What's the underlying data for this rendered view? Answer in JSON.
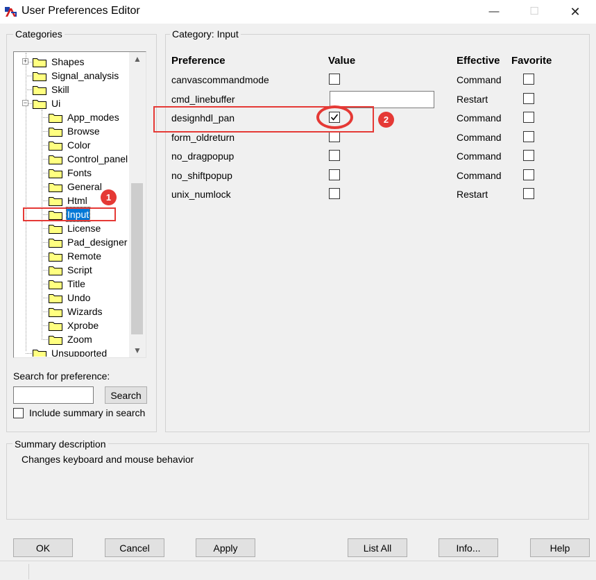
{
  "window": {
    "title": "User Preferences Editor",
    "minimize_glyph": "—",
    "maximize_glyph": "☐",
    "close_glyph": "✕"
  },
  "categories": {
    "title": "Categories",
    "tree": [
      {
        "label": "Shapes",
        "depth": 1,
        "expander": "+"
      },
      {
        "label": "Signal_analysis",
        "depth": 1
      },
      {
        "label": "Skill",
        "depth": 1
      },
      {
        "label": "Ui",
        "depth": 1,
        "expander": "−"
      },
      {
        "label": "App_modes",
        "depth": 2
      },
      {
        "label": "Browse",
        "depth": 2
      },
      {
        "label": "Color",
        "depth": 2
      },
      {
        "label": "Control_panel",
        "depth": 2
      },
      {
        "label": "Fonts",
        "depth": 2
      },
      {
        "label": "General",
        "depth": 2
      },
      {
        "label": "Html",
        "depth": 2
      },
      {
        "label": "Input",
        "depth": 2,
        "selected": true
      },
      {
        "label": "License",
        "depth": 2
      },
      {
        "label": "Pad_designer",
        "depth": 2
      },
      {
        "label": "Remote",
        "depth": 2
      },
      {
        "label": "Script",
        "depth": 2
      },
      {
        "label": "Title",
        "depth": 2
      },
      {
        "label": "Undo",
        "depth": 2
      },
      {
        "label": "Wizards",
        "depth": 2
      },
      {
        "label": "Xprobe",
        "depth": 2
      },
      {
        "label": "Zoom",
        "depth": 2
      },
      {
        "label": "Unsupported",
        "depth": 1
      }
    ],
    "scroll_up_glyph": "▲",
    "scroll_down_glyph": "▼"
  },
  "search": {
    "label": "Search for preference:",
    "value": "",
    "button_label": "Search",
    "include_summary_label": "Include summary in search",
    "include_summary_checked": false
  },
  "category_panel": {
    "title": "Category:  Input",
    "headers": {
      "preference": "Preference",
      "value": "Value",
      "effective": "Effective",
      "favorite": "Favorite"
    },
    "rows": [
      {
        "name": "canvascommandmode",
        "type": "checkbox",
        "checked": false,
        "effective": "Command",
        "favorite": false
      },
      {
        "name": "cmd_linebuffer",
        "type": "text",
        "value": "",
        "effective": "Restart",
        "favorite": false
      },
      {
        "name": "designhdl_pan",
        "type": "checkbox",
        "checked": true,
        "effective": "Command",
        "favorite": false
      },
      {
        "name": "form_oldreturn",
        "type": "checkbox",
        "checked": false,
        "effective": "Command",
        "favorite": false
      },
      {
        "name": "no_dragpopup",
        "type": "checkbox",
        "checked": false,
        "effective": "Command",
        "favorite": false
      },
      {
        "name": "no_shiftpopup",
        "type": "checkbox",
        "checked": false,
        "effective": "Command",
        "favorite": false
      },
      {
        "name": "unix_numlock",
        "type": "checkbox",
        "checked": false,
        "effective": "Restart",
        "favorite": false
      }
    ]
  },
  "summary": {
    "title": "Summary description",
    "text": "Changes keyboard and mouse behavior"
  },
  "buttons": {
    "ok": "OK",
    "cancel": "Cancel",
    "apply": "Apply",
    "list_all": "List All",
    "info": "Info...",
    "help": "Help"
  },
  "annotations": {
    "badge_1": "1",
    "badge_2": "2",
    "color": "#e53935"
  },
  "colors": {
    "selection": "#0078d7",
    "folder_fill": "#ffff80",
    "window_bg": "#f0f0f0"
  },
  "icons": {
    "app": "allegro-app-icon",
    "folder": "folder-icon",
    "check": "checkmark-icon"
  }
}
